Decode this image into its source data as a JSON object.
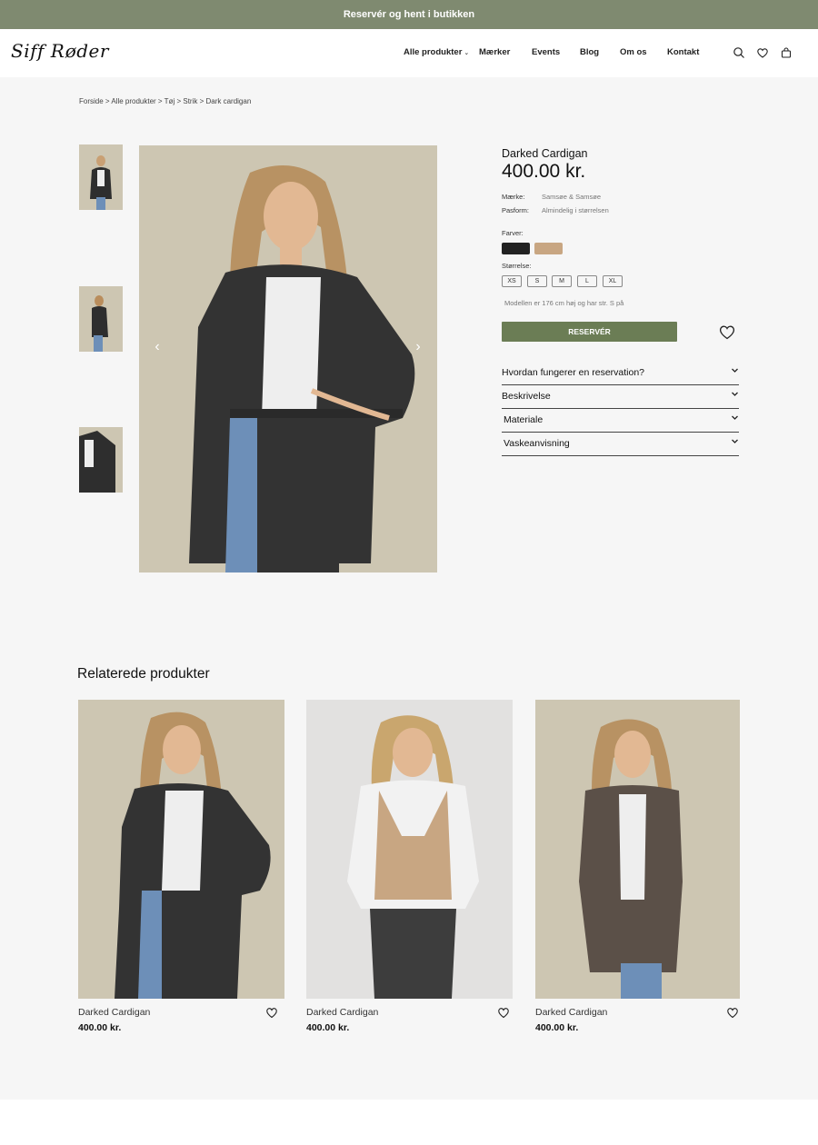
{
  "announcement": "Reservér og hent i butikken",
  "brand": {
    "logo_text": "Siff Røder"
  },
  "nav": {
    "items": [
      "Alle produkter",
      "Mærker",
      "Events",
      "Blog",
      "Om os",
      "Kontakt"
    ],
    "dropdown_chevron": "⌄"
  },
  "breadcrumb": "Forside > Alle produkter > Tøj > Strik  > Dark cardigan",
  "product": {
    "title": "Darked Cardigan",
    "price": "400.00 kr.",
    "brand_label": "Mærke:",
    "brand_value": "Samsøe & Samsøe",
    "fit_label": "Pasform:",
    "fit_value": "Almindelig i størrelsen",
    "colors_label": "Farver:",
    "colors": [
      "#222222",
      "#c8a682"
    ],
    "sizes_label": "Størrelse:",
    "sizes": [
      "XS",
      "S",
      "M",
      "L",
      "XL"
    ],
    "model_note": "Modellen er 176 cm høj og har str. S på",
    "reserve_label": "RESERVÉR",
    "accordion": [
      "Hvordan fungerer en reservation?",
      "Beskrivelse",
      "Materiale",
      "Vaskeanvisning"
    ]
  },
  "carousel": {
    "prev": "‹",
    "next": "›"
  },
  "related": {
    "title": "Relaterede produkter",
    "items": [
      {
        "name": "Darked Cardigan",
        "price": "400.00 kr."
      },
      {
        "name": "Darked Cardigan",
        "price": "400.00 kr."
      },
      {
        "name": "Darked Cardigan",
        "price": "400.00 kr."
      }
    ]
  },
  "colors": {
    "topbar": "#7f8a70",
    "reserve_button": "#6b7d55",
    "photo_bg": "#cdc6b2"
  }
}
